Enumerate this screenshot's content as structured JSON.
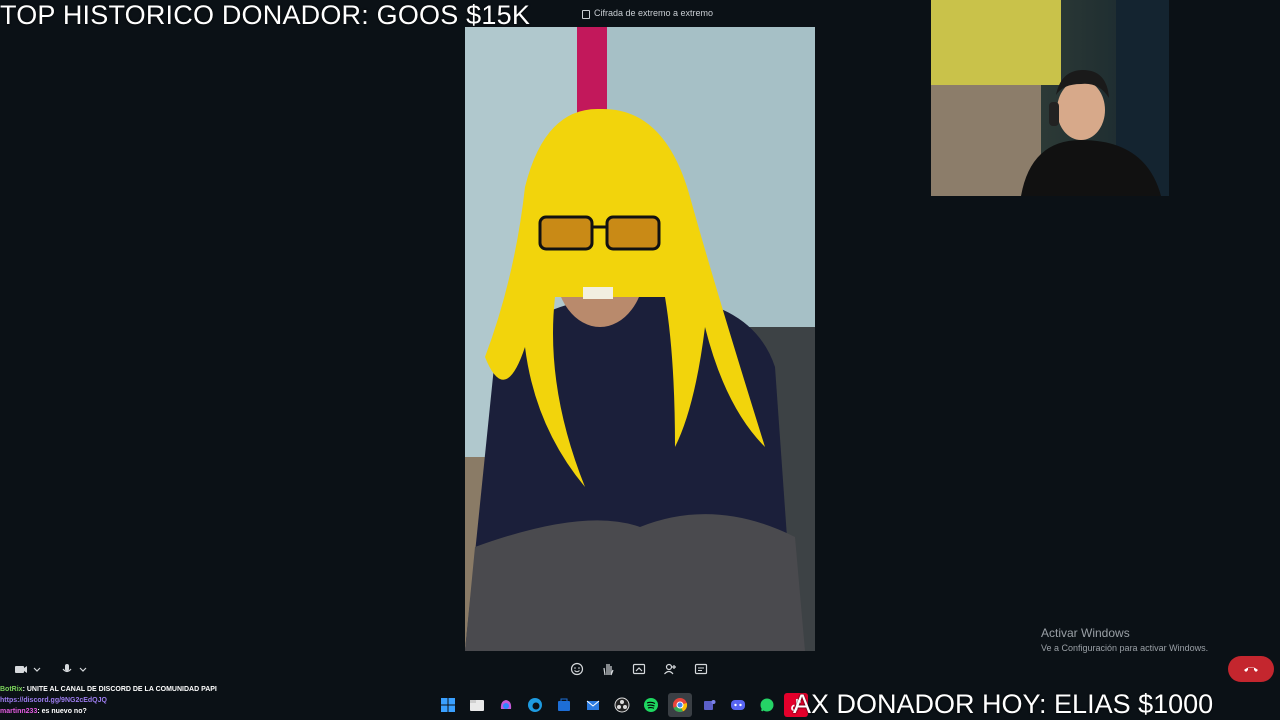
{
  "overlay": {
    "top_donor": "TOP HISTORICO DONADOR: GOOS $15K",
    "today_donor": "AX DONADOR HOY: ELIAS $1000"
  },
  "call": {
    "encryption_label": "Cifrada de extremo a extremo"
  },
  "watermark": {
    "title": "Activar Windows",
    "subtitle": "Ve a Configuración para activar Windows."
  },
  "chat": [
    {
      "user": "BotRix",
      "message": ": UNITE AL CANAL DE DISCORD DE LA COMUNIDAD PAPI"
    },
    {
      "user": "",
      "message": "https://discord.gg/9NG2cEdQJQ"
    },
    {
      "user": "martinn233",
      "message": ": es nuevo no?"
    }
  ],
  "toolbar_icons": [
    "emoji-icon",
    "raise-hand-icon",
    "share-screen-icon",
    "add-person-icon",
    "captions-icon"
  ],
  "taskbar_apps": [
    "windows-start-icon",
    "file-explorer-icon",
    "copilot-icon",
    "edge-icon",
    "store-icon",
    "mail-icon",
    "obs-icon",
    "spotify-icon",
    "chrome-icon",
    "teams-icon",
    "discord-icon",
    "whatsapp-icon",
    "tiktok-icon"
  ],
  "colors": {
    "hangup": "#c4262e",
    "background": "#0b1116"
  }
}
